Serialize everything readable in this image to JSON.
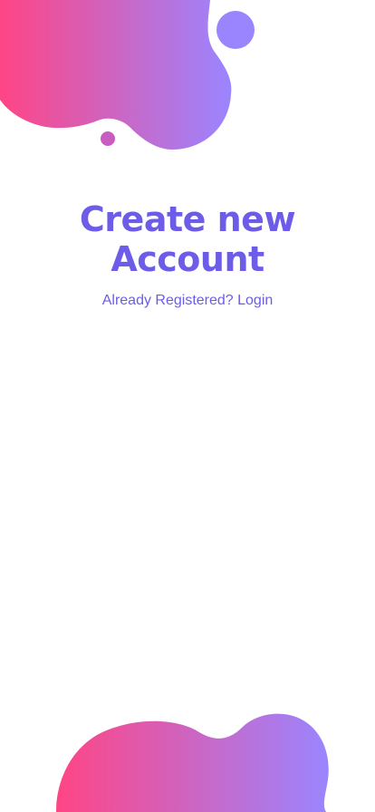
{
  "header": {
    "title_line1": "Create new",
    "title_line2": "Account",
    "login_prompt": "Already Registered? Login"
  },
  "colors": {
    "accent": "#6c5ce7",
    "gradient_start": "#ff4585",
    "gradient_end": "#9a85ff",
    "dot_small": "#c85cc0",
    "dot_large": "#9a85ff"
  },
  "icons": [
    "top-blob-shape",
    "bottom-blob-shape",
    "decorative-dot"
  ]
}
